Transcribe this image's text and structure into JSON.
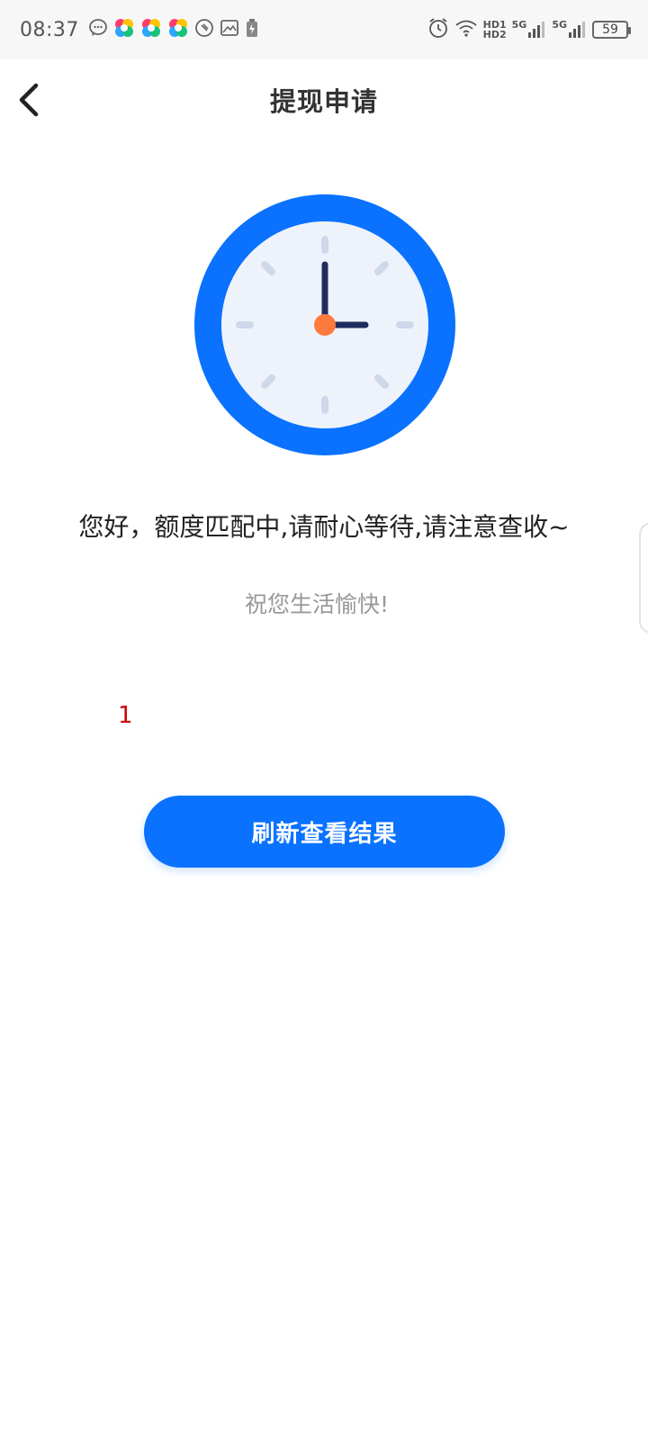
{
  "status_bar": {
    "time": "08:37",
    "notification_icons": [
      "message-bubble-icon",
      "colorful-app-icon",
      "colorful-app-icon",
      "colorful-app-icon",
      "link-icon",
      "gallery-icon",
      "battery-saver-icon"
    ],
    "right_icons": [
      "alarm-icon",
      "wifi-icon",
      "hd-indicator",
      "signal-5g-icon",
      "signal-5g-icon",
      "battery-icon"
    ],
    "hd_top": "HD1",
    "hd_bottom": "HD2",
    "network_1": "5G",
    "network_2": "5G",
    "battery_level": "59"
  },
  "nav": {
    "title": "提现申请"
  },
  "main": {
    "message": "您好，额度匹配中,请耐心等待,请注意查收~",
    "sub_message": "祝您生活愉快!",
    "red_number": "1",
    "refresh_button_label": "刷新查看结果"
  },
  "colors": {
    "accent": "#0a72ff",
    "clock_face": "#eef3fb",
    "clock_hands": "#1f2d5e",
    "clock_center": "#ff7a3d",
    "tick_marks": "#cfd8ea",
    "red_text": "#cc0000"
  }
}
